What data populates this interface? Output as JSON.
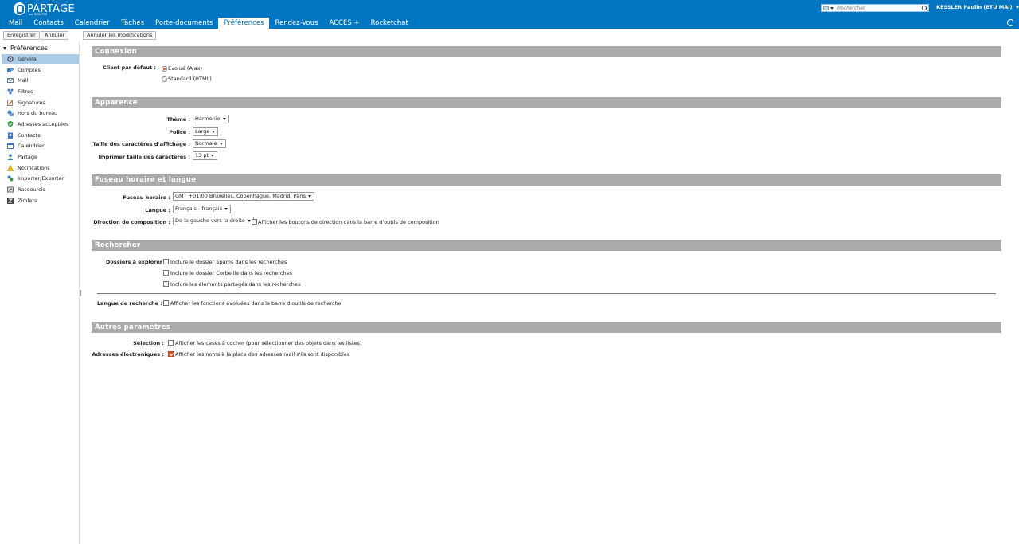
{
  "header": {
    "logo_text": "PARTAGE",
    "logo_sub": "par RENATER",
    "search_placeholder": "Rechercher",
    "user": "KESSLER Paulin (ETU MAI)"
  },
  "app_tabs": [
    "Mail",
    "Contacts",
    "Calendrier",
    "Tâches",
    "Porte-documents",
    "Préférences",
    "Rendez-Vous",
    "ACCES +",
    "Rocketchat"
  ],
  "toolbar": {
    "save": "Enregistrer",
    "cancel": "Annuler",
    "undo": "Annuler les modifications"
  },
  "sidebar": {
    "title": "Préférences",
    "items": [
      "Général",
      "Comptes",
      "Mail",
      "Filtres",
      "Signatures",
      "Hors du bureau",
      "Adresses acceptées",
      "Contacts",
      "Calendrier",
      "Partage",
      "Notifications",
      "Importer/Exporter",
      "Raccourcis",
      "Zimlets"
    ]
  },
  "sections": {
    "connexion": {
      "title": "Connexion",
      "client_label": "Client par défaut :",
      "opt_ajax": "Évolué (Ajax)",
      "opt_html": "Standard (HTML)"
    },
    "apparence": {
      "title": "Apparence",
      "theme_label": "Thème :",
      "theme_value": "Harmonie",
      "police_label": "Police :",
      "police_value": "Large",
      "size_label": "Taille des caractères d'affichage :",
      "size_value": "Normale",
      "print_label": "Imprimer taille des caractères :",
      "print_value": "13 pt"
    },
    "fuseau": {
      "title": "Fuseau horaire et langue",
      "tz_label": "Fuseau horaire :",
      "tz_value": "GMT +01:00 Bruxelles, Copenhague, Madrid, Paris",
      "lang_label": "Langue :",
      "lang_value": "Français - français",
      "dir_label": "Direction de composition :",
      "dir_value": "De la gauche vers la droite",
      "dir_check": "Afficher les boutons de direction dans la barre d'outils de composition"
    },
    "rechercher": {
      "title": "Rechercher",
      "folders_label": "Dossiers à explorer",
      "spam": "Inclure le dossier Spams dans les recherches",
      "trash": "Inclure le dossier Corbeille dans les recherches",
      "shared": "Inclure les éléments partagés dans les recherches",
      "lang_label": "Langue de recherche :",
      "lang_check": "Afficher les fonctions évoluées dans la barre d'outils de recherche"
    },
    "autres": {
      "title": "Autres paramètres",
      "sel_label": "Sélection :",
      "sel_check": "Afficher les cases à cocher (pour sélectionner des objets dans les listes)",
      "addr_label": "Adresses électroniques :",
      "addr_check": "Afficher les noms à la place des adresses mail s'ils sont disponibles"
    }
  },
  "colors": {
    "brand": "#0075c2",
    "section_bar": "#aaaaaa",
    "selected_nav": "#a9cde9",
    "accent": "#e0452b"
  }
}
